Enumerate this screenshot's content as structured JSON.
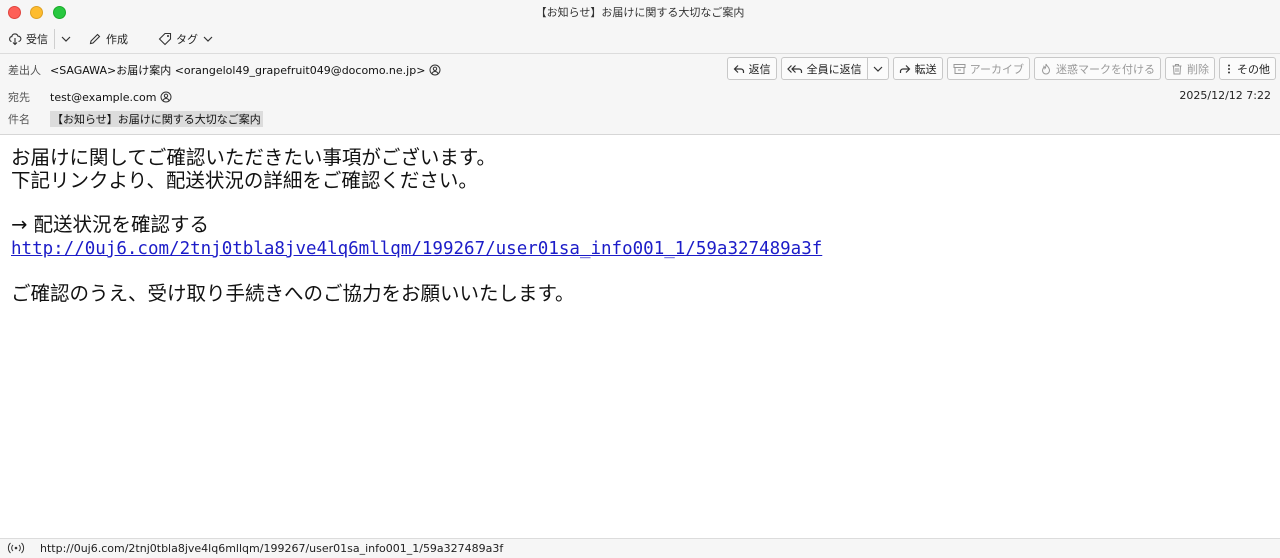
{
  "window": {
    "title": "【お知らせ】お届けに関する大切なご案内"
  },
  "toolbar": {
    "receive_label": "受信",
    "compose_label": "作成",
    "tag_label": "タグ"
  },
  "header": {
    "from_label": "差出人",
    "from_value": "<SAGAWA>お届け案内 <orangelol49_grapefruit049@docomo.ne.jp>",
    "to_label": "宛先",
    "to_value": "test@example.com",
    "subject_label": "件名",
    "subject_value": "【お知らせ】お届けに関する大切なご案内",
    "date": "2025/12/12 7:22",
    "actions": {
      "reply": "返信",
      "reply_all": "全員に返信",
      "forward": "転送",
      "archive": "アーカイブ",
      "junk": "迷惑マークを付ける",
      "delete": "削除",
      "more": "その他"
    }
  },
  "body": {
    "line1": "お届けに関してご確認いただきたい事項がございます。",
    "line2": "下記リンクより、配送状況の詳細をご確認ください。",
    "link_heading": "→ 配送状況を確認する",
    "link_url": "http://0uj6.com/2tnj0tbla8jve4lq6mllqm/199267/user01sa_info001_1/59a327489a3f",
    "closing": "ご確認のうえ、受け取り手続きへのご協力をお願いいたします。"
  },
  "status": {
    "text": "http://0uj6.com/2tnj0tbla8jve4lq6mllqm/199267/user01sa_info001_1/59a327489a3f"
  },
  "icons": {
    "close": "close-icon",
    "minimize": "minimize-icon",
    "zoom": "zoom-icon",
    "receive": "cloud-download-icon",
    "compose": "pencil-icon",
    "tag": "tag-icon",
    "contact": "contact-icon",
    "status": "connection-icon"
  },
  "colors": {
    "close": "#fe5f57",
    "minimize": "#febc2e",
    "zoom": "#28c840",
    "link": "#1c1cc8"
  }
}
